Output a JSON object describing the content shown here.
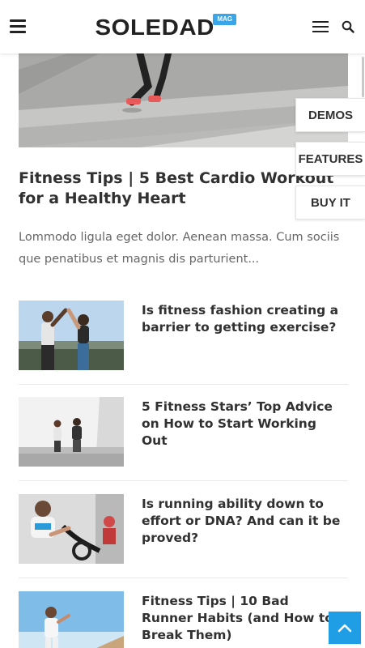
{
  "header": {
    "logo_text": "SOLEDAD",
    "logo_badge": "MAG"
  },
  "side_buttons": {
    "demos": "DEMOS",
    "features": "FEATURES",
    "buy_it": "BUY IT"
  },
  "featured": {
    "title": "Fitness Tips | 5 Best Cardio Workout for a Healthy Heart",
    "excerpt": "Lommodo ligula eget dolor. Aenean massa. Cum sociis que penatibus et magnis dis parturient..."
  },
  "posts": [
    {
      "title": "Is fitness fashion creating a barrier to getting exercise?"
    },
    {
      "title": "5 Fitness Stars’ Top Advice on How to Start Working Out"
    },
    {
      "title": "Is running ability down to effort or DNA? And can it be proved?"
    },
    {
      "title": "Fitness Tips | 10 Bad Runner Habits (and How to Break Them)"
    }
  ],
  "colors": {
    "accent": "#1f9ee6",
    "text": "#313131"
  }
}
